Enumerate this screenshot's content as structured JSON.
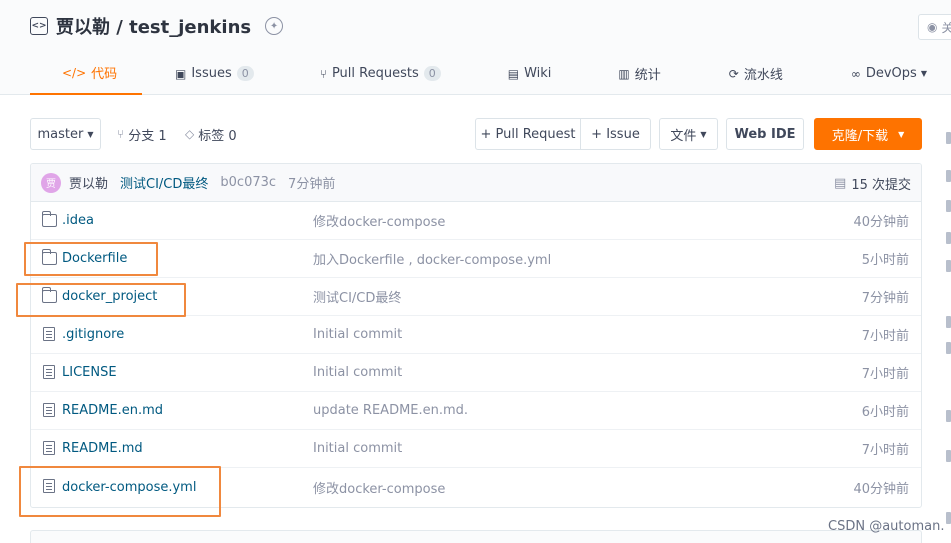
{
  "repo": {
    "title": "贾以勒 / test_jenkins",
    "watch_label": "关"
  },
  "tabs": [
    {
      "icon": "</>",
      "label": "代码"
    },
    {
      "icon": "▣",
      "label": "Issues",
      "count": "0"
    },
    {
      "icon": "⑂",
      "label": "Pull Requests",
      "count": "0"
    },
    {
      "icon": "▤",
      "label": "Wiki"
    },
    {
      "icon": "▥",
      "label": "统计"
    },
    {
      "icon": "⟳",
      "label": "流水线"
    },
    {
      "icon": "∞",
      "label": "DevOps"
    }
  ],
  "toolbar": {
    "branch": "master",
    "branches": "分支 1",
    "tags": "标签 0",
    "new_pr": "+ Pull Request",
    "new_issue": "+ Issue",
    "files": "文件",
    "web_ide": "Web IDE",
    "clone": "克隆/下载"
  },
  "last_commit": {
    "avatar": "贾",
    "author": "贾以勒",
    "message": "测试CI/CD最终",
    "sha": "b0c073c",
    "time": "7分钟前",
    "count": "15 次提交"
  },
  "files": [
    {
      "type": "folder",
      "name": ".idea",
      "message": "修改docker-compose",
      "time": "40分钟前"
    },
    {
      "type": "folder",
      "name": "Dockerfile",
      "message": "加入Dockerfile , docker-compose.yml",
      "time": "5小时前"
    },
    {
      "type": "folder",
      "name": "docker_project",
      "message": "测试CI/CD最终",
      "time": "7分钟前"
    },
    {
      "type": "file",
      "name": ".gitignore",
      "message": "Initial commit",
      "time": "7小时前"
    },
    {
      "type": "file",
      "name": "LICENSE",
      "message": "Initial commit",
      "time": "7小时前"
    },
    {
      "type": "file",
      "name": "README.en.md",
      "message": "update README.en.md.",
      "time": "6小时前"
    },
    {
      "type": "file",
      "name": "README.md",
      "message": "Initial commit",
      "time": "7小时前"
    },
    {
      "type": "file",
      "name": "docker-compose.yml",
      "message": "修改docker-compose",
      "time": "40分钟前"
    }
  ],
  "colors": {
    "accent": "#fe7300",
    "link": "#005980",
    "highlight": "#f0883e"
  },
  "watermark": "CSDN @automan."
}
